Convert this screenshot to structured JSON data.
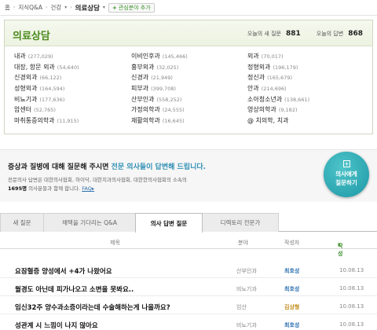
{
  "breadcrumb": {
    "items": [
      "홈",
      "지식Q&A",
      "건강",
      "의료상담"
    ],
    "add_label": "관심분야 추가"
  },
  "category_panel": {
    "title": "의료상담",
    "stats": [
      {
        "label": "오늘의 새 질문",
        "value": "881"
      },
      {
        "label": "오늘의 답변",
        "value": "868"
      }
    ],
    "categories": [
      {
        "name": "내과",
        "count": "(277,029)"
      },
      {
        "name": "이비인후과",
        "count": "(145,466)"
      },
      {
        "name": "외과",
        "count": "(70,017)"
      },
      {
        "name": "대장, 항문 외과",
        "count": "(54,640)"
      },
      {
        "name": "흉부외과",
        "count": "(32,025)"
      },
      {
        "name": "정형외과",
        "count": "(196,179)"
      },
      {
        "name": "신경외과",
        "count": "(66,122)"
      },
      {
        "name": "신경과",
        "count": "(21,949)"
      },
      {
        "name": "정신과",
        "count": "(165,679)"
      },
      {
        "name": "성형외과",
        "count": "(164,594)"
      },
      {
        "name": "피부과",
        "count": "(399,708)"
      },
      {
        "name": "안과",
        "count": "(214,696)"
      },
      {
        "name": "비뇨기과",
        "count": "(177,636)"
      },
      {
        "name": "산부인과",
        "count": "(558,252)"
      },
      {
        "name": "소아청소년과",
        "count": "(138,661)"
      },
      {
        "name": "암센터",
        "count": "(52,765)"
      },
      {
        "name": "가정의학과",
        "count": "(24,555)"
      },
      {
        "name": "영상의학과",
        "count": "(9,182)"
      },
      {
        "name": "마취통증의학과",
        "count": "(11,915)"
      },
      {
        "name": "재활의학과",
        "count": "(16,645)"
      },
      {
        "name": "@ 치의학, 치과",
        "count": ""
      }
    ]
  },
  "ask": {
    "heading_pre": "증상과 질병에 대해 질문해 주시면 ",
    "heading_hl": "전문 의사들이 답변해 드립니다.",
    "desc1": "전문의사 답변은 대한의사협회, 하이닥, 대한치과의사협회, 대한한의사협회의 소속의",
    "desc2_count": "1695명",
    "desc2_mid": " 의사분들과 함께 합니다. ",
    "desc2_link": "FAQ",
    "desc2_arrow": "▸",
    "button_icon": "+",
    "button_line1": "의사에게",
    "button_line2": "질문하기"
  },
  "tabs": [
    "새 질문",
    "채택을 기다리는 Q&A",
    "의사 답변 질문",
    "디렉토리 전문가"
  ],
  "active_tab": 2,
  "table": {
    "headers": {
      "title": "제목",
      "field": "분야",
      "author": "작성자",
      "date": "작성"
    },
    "rows": [
      {
        "title": "요잠혈증 양성에서 +4가 나왔어요",
        "field": "산부인과",
        "author": "최호성",
        "date": "10.08.13"
      },
      {
        "title": "월경도 아닌데 피가나오고 소변을 못봐요..",
        "field": "비뇨기과",
        "author": "최호성",
        "date": "10.08.13"
      },
      {
        "title": "임신32주 양수과소증이라는데 수술해하는게 나을까요?",
        "field": "임산",
        "author": "김상형",
        "date": "10.08.13"
      },
      {
        "title": "성관계 시 느낌이 나지 않아요",
        "field": "비뇨기과",
        "author": "최호성",
        "date": "10.08.13"
      }
    ]
  }
}
